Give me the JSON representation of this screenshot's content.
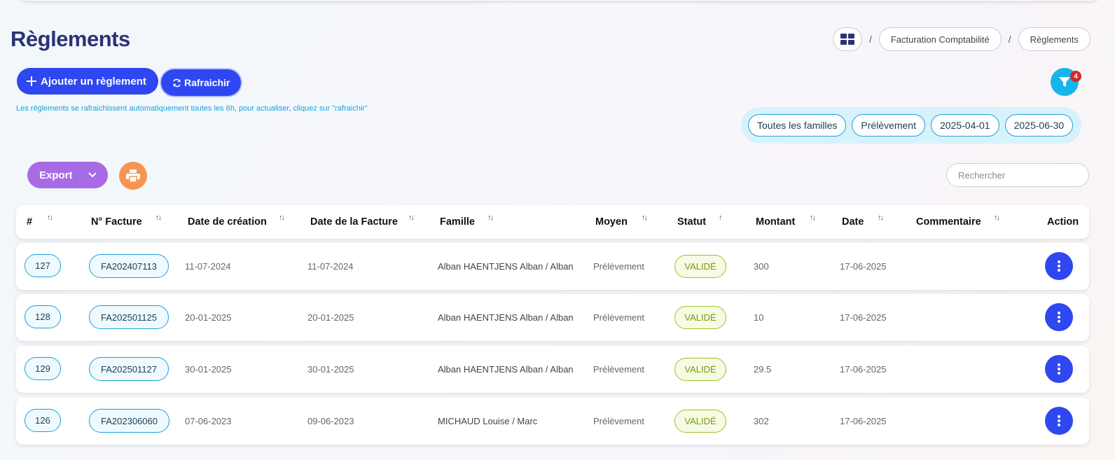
{
  "page": {
    "title": "Règlements"
  },
  "breadcrumb": {
    "home_icon": "dashboard-grid-icon",
    "separator": "/",
    "items": [
      "Facturation Comptabilité",
      "Règlements"
    ]
  },
  "toolbar": {
    "add_label": "Ajouter un règlement",
    "refresh_label": "Rafraichir",
    "hint": "Les règlements se rafraichissent automatiquement toutes les 6h, pour actualiser, cliquez sur \"rafraichir\"",
    "filter_count": "4",
    "export_label": "Export",
    "search_placeholder": "Rechercher"
  },
  "filters": [
    "Toutes les familles",
    "Prélèvement",
    "2025-04-01",
    "2025-06-30"
  ],
  "table": {
    "columns": [
      "#",
      "N° Facture",
      "Date de création",
      "Date de la Facture",
      "Famille",
      "Moyen",
      "Statut",
      "Montant",
      "Date",
      "Commentaire",
      "Action"
    ],
    "rows": [
      {
        "id": "127",
        "invoice": "FA202407113",
        "created": "11-07-2024",
        "invoice_date": "11-07-2024",
        "family": "Alban HAENTJENS Alban / Alban",
        "method": "Prélèvement",
        "status": "VALIDÉ",
        "amount": "300",
        "date": "17-06-2025",
        "comment": ""
      },
      {
        "id": "128",
        "invoice": "FA202501125",
        "created": "20-01-2025",
        "invoice_date": "20-01-2025",
        "family": "Alban HAENTJENS Alban / Alban",
        "method": "Prélèvement",
        "status": "VALIDÉ",
        "amount": "10",
        "date": "17-06-2025",
        "comment": ""
      },
      {
        "id": "129",
        "invoice": "FA202501127",
        "created": "30-01-2025",
        "invoice_date": "30-01-2025",
        "family": "Alban HAENTJENS Alban / Alban",
        "method": "Prélèvement",
        "status": "VALIDÉ",
        "amount": "29.5",
        "date": "17-06-2025",
        "comment": ""
      },
      {
        "id": "126",
        "invoice": "FA202306060",
        "created": "07-06-2023",
        "invoice_date": "09-06-2023",
        "family": "MICHAUD Louise / Marc",
        "method": "Prélèvement",
        "status": "VALIDÉ",
        "amount": "302",
        "date": "17-06-2025",
        "comment": ""
      }
    ]
  },
  "colors": {
    "primary": "#2f47f0",
    "accent_cyan": "#16b6e8",
    "export_purple": "#a86be6",
    "print_orange": "#f69550",
    "status_green": "#9dc02c",
    "title_navy": "#2b3377"
  }
}
